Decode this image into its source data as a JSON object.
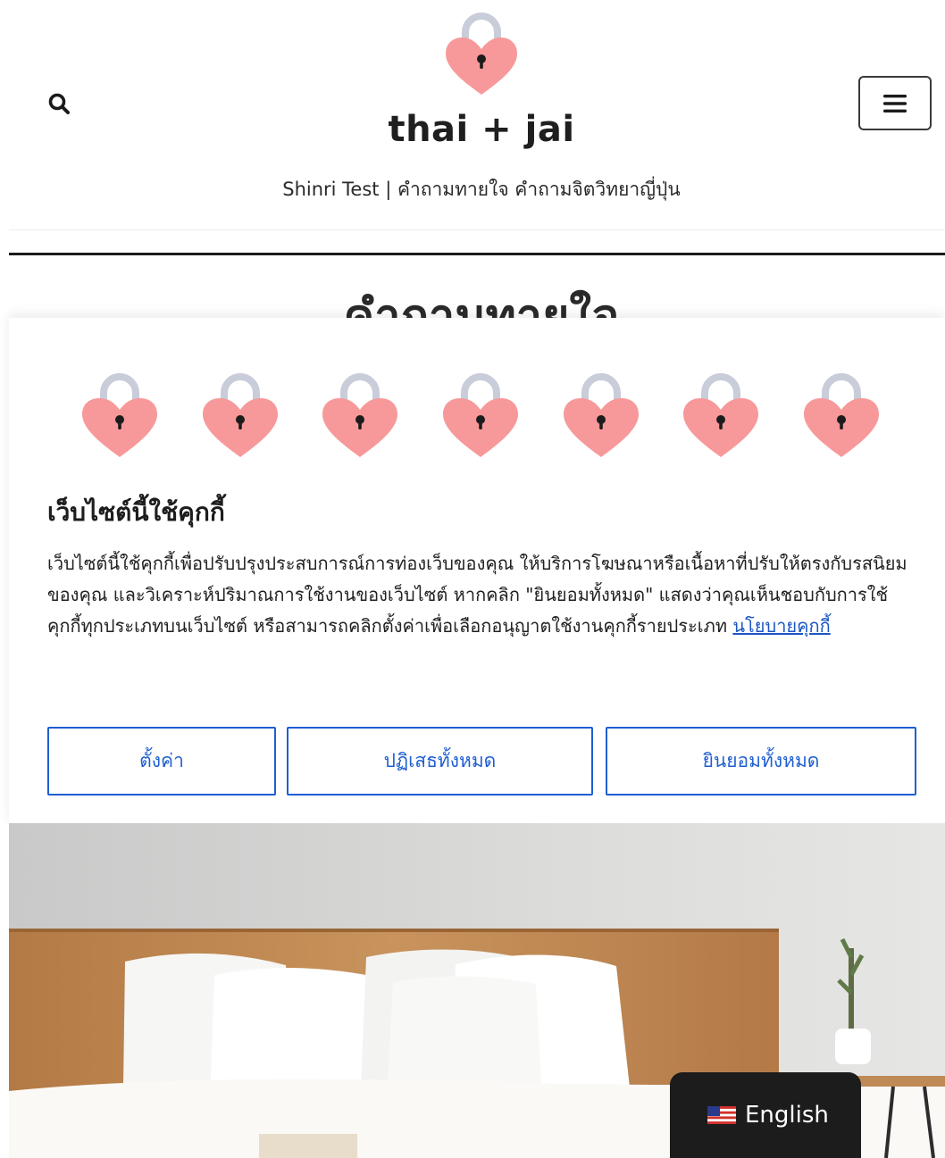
{
  "header": {
    "site_title": "thai + jai",
    "tagline": "Shinri Test | คำถามทายใจ คำถามจิตวิทยาญี่ปุ่น",
    "page_heading": "คำถามทายใจ"
  },
  "cookie_banner": {
    "title": "เว็บไซต์นี้ใช้คุกกี้",
    "body_text": "เว็บไซต์นี้ใช้คุกกี้เพื่อปรับปรุงประสบการณ์การท่องเว็บของคุณ ให้บริการโฆษณาหรือเนื้อหาที่ปรับให้ตรงกับรสนิยมของคุณ และวิเคราะห์ปริมาณการใช้งานของเว็บไซต์ หากคลิก \"ยินยอมทั้งหมด\" แสดงว่าคุณเห็นชอบกับการใช้คุกกี้ทุกประเภทบนเว็บไซต์ หรือสามารถคลิกตั้งค่าเพื่อเลือกอนุญาตใช้งานคุกกี้รายประเภท",
    "policy_link": "นโยบายคุกกี้",
    "settings_label": "ตั้งค่า",
    "reject_label": "ปฏิเสธทั้งหมด",
    "accept_label": "ยินยอมทั้งหมด"
  },
  "language_switcher": {
    "label": "English",
    "flag_icon": "us-flag-icon"
  },
  "colors": {
    "accent_blue": "#1f5fd1",
    "heart_pink": "#f7999a",
    "shackle_gray": "#c9ccd9",
    "dark_text": "#1f1f1f"
  }
}
